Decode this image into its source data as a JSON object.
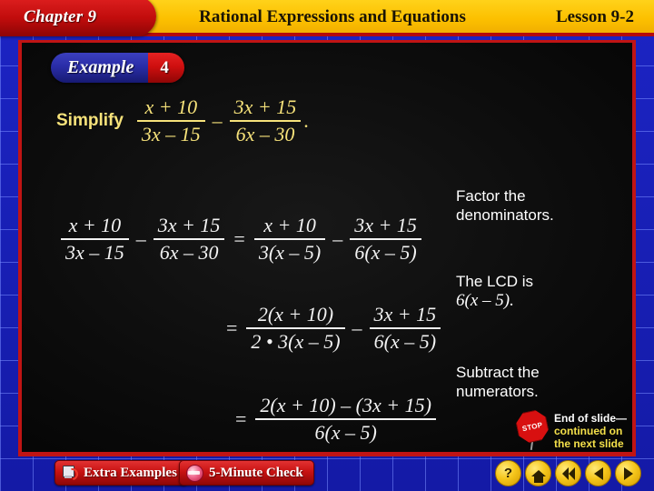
{
  "header": {
    "chapter": "Chapter 9",
    "title": "Rational Expressions and Equations",
    "lesson": "Lesson 9-2"
  },
  "badge": {
    "word": "Example",
    "number": "4"
  },
  "problem": {
    "directive": "Simplify",
    "fraction1": {
      "numerator": "x + 10",
      "denominator": "3x – 15"
    },
    "operator": "–",
    "fraction2": {
      "numerator": "3x + 15",
      "denominator": "6x – 30"
    },
    "period": "."
  },
  "steps": {
    "step1": {
      "left_f1": {
        "numerator": "x + 10",
        "denominator": "3x – 15"
      },
      "left_op": "–",
      "left_f2": {
        "numerator": "3x + 15",
        "denominator": "6x – 30"
      },
      "equals": "=",
      "right_f1": {
        "numerator": "x + 10",
        "denominator": "3(x – 5)"
      },
      "right_op": "–",
      "right_f2": {
        "numerator": "3x + 15",
        "denominator": "6(x – 5)"
      }
    },
    "step2": {
      "equals": "=",
      "f1": {
        "numerator": "2(x + 10)",
        "denominator": "2 • 3(x – 5)"
      },
      "op": "–",
      "f2": {
        "numerator": "3x + 15",
        "denominator": "6(x – 5)"
      }
    },
    "step3": {
      "equals": "=",
      "f1": {
        "numerator": "2(x + 10) – (3x + 15)",
        "denominator": "6(x – 5)"
      }
    }
  },
  "notes": {
    "note1": "Factor the denominators.",
    "note2_line1": "The LCD is",
    "note2_line2": "6(x – 5).",
    "note3": "Subtract the numerators."
  },
  "end_of_slide": {
    "sign_text": "STOP",
    "line1": "End of slide—",
    "line2": "continued on",
    "line3": "the next slide"
  },
  "bottom": {
    "extra_examples": "Extra Examples",
    "five_minute_check": "5-Minute Check"
  },
  "nav": {
    "help": "?",
    "home": "home",
    "restart": "restart",
    "previous": "previous",
    "next": "next"
  },
  "colors": {
    "header_yellow": "#fcc000",
    "chapter_red": "#c00c0c",
    "frame_blue": "#1c24c4",
    "panel_black": "#0d0d0d",
    "problem_yellow": "#f6e27a",
    "note_white": "#ffffff",
    "end_yellow": "#f4e04a"
  }
}
